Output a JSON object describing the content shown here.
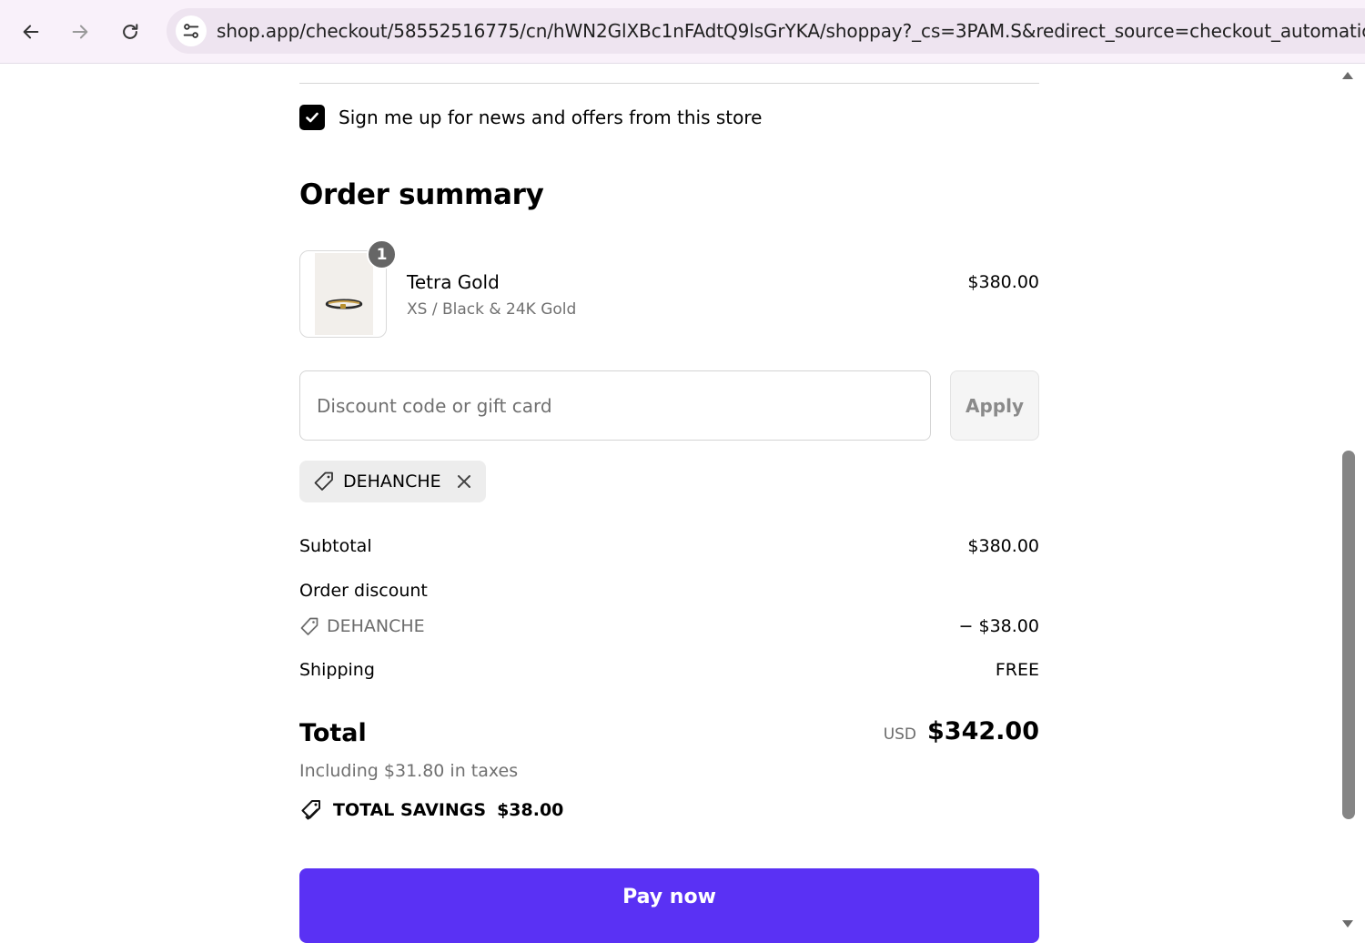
{
  "browser": {
    "url": "shop.app/checkout/58552516775/cn/hWN2GlXBc1nFAdtQ9lsGrYKA/shoppay?_cs=3PAM.S&redirect_source=checkout_automatic_redire"
  },
  "newsletter": {
    "label": "Sign me up for news and offers from this store",
    "checked": true
  },
  "order_summary": {
    "title": "Order summary",
    "item": {
      "quantity": "1",
      "name": "Tetra Gold",
      "variant": "XS / Black & 24K Gold",
      "price": "$380.00"
    },
    "discount": {
      "placeholder": "Discount code or gift card",
      "value": "",
      "apply_label": "Apply",
      "applied_code": "DEHANCHE"
    },
    "subtotal": {
      "label": "Subtotal",
      "value": "$380.00"
    },
    "order_discount": {
      "label": "Order discount",
      "code": "DEHANCHE",
      "value": "− $38.00"
    },
    "shipping": {
      "label": "Shipping",
      "value": "FREE"
    },
    "total": {
      "label": "Total",
      "currency": "USD",
      "value": "$342.00",
      "taxes_note": "Including $31.80 in taxes"
    },
    "savings": {
      "label": "TOTAL SAVINGS",
      "value": "$38.00"
    },
    "pay_label": "Pay now"
  },
  "colors": {
    "pay_button": "#5a31f4",
    "chrome_background": "#f9f1fa"
  }
}
